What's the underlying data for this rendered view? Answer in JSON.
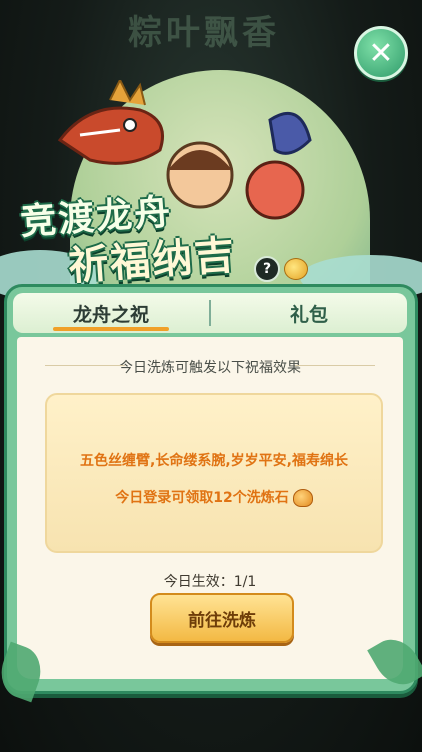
{
  "banner": {
    "faded_title": "粽叶飘香",
    "line1": "竞渡龙舟",
    "line2": "祈福纳吉",
    "help_icon": "question-icon",
    "close_icon": "close-icon",
    "coin_icon": "coin-icon"
  },
  "tabs": [
    {
      "label": "龙舟之祝",
      "active": true
    },
    {
      "label": "礼包",
      "active": false
    }
  ],
  "panel": {
    "section_title": "今日洗炼可触发以下祝福效果",
    "blessing": "五色丝缠臂,长命缕系腕,岁岁平安,福寿绵长",
    "reward": "今日登录可领取12个洗炼石",
    "reward_icon": "wash-stone-icon",
    "effect": "今日生效：1/1",
    "button_label": "前往洗炼"
  },
  "colors": {
    "accent_orange": "#e07313",
    "panel_green": "#79c79b",
    "button_gold": "#f3b944"
  }
}
